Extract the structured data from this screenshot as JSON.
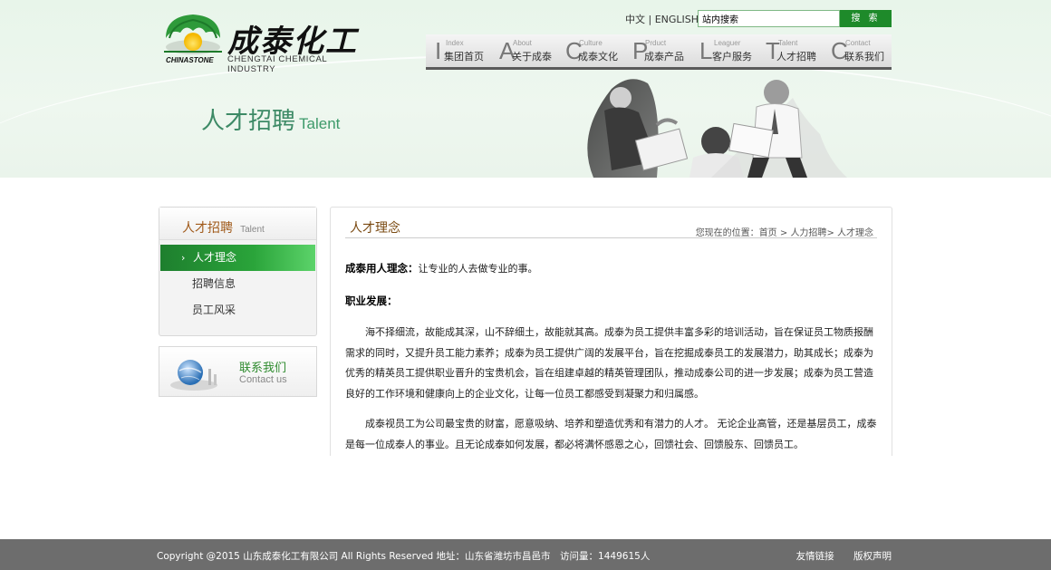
{
  "logo": {
    "brand_cn": "成泰化工",
    "brand_en": "CHENGTAI CHEMICAL INDUSTRY",
    "brand_small": "CHINASTONE"
  },
  "header": {
    "lang_cn": "中文",
    "lang_sep": "|",
    "lang_en": "ENGLISH",
    "search_value": "站内搜索",
    "search_button": "搜 索"
  },
  "nav": [
    {
      "letter": "I",
      "en": "Index",
      "cn": "集团首页"
    },
    {
      "letter": "A",
      "en": "About",
      "cn": "关于成泰"
    },
    {
      "letter": "C",
      "en": "Culture",
      "cn": "成泰文化"
    },
    {
      "letter": "P",
      "en": "Prduct",
      "cn": "成泰产品"
    },
    {
      "letter": "L",
      "en": "Leaguer",
      "cn": "客户服务"
    },
    {
      "letter": "T",
      "en": "Talent",
      "cn": "人才招聘"
    },
    {
      "letter": "C",
      "en": "Contact",
      "cn": "联系我们"
    }
  ],
  "banner": {
    "title_cn": "人才招聘",
    "title_en": "Talent"
  },
  "sidebar": {
    "title_cn": "人才招聘",
    "title_en": "Talent",
    "items": [
      {
        "label": "人才理念"
      },
      {
        "label": "招聘信息"
      },
      {
        "label": "员工风采"
      }
    ],
    "contact_cn": "联系我们",
    "contact_en": "Contact us"
  },
  "main": {
    "title": "人才理念",
    "breadcrumb_prefix": "您现在的位置：",
    "breadcrumb": [
      "首页",
      "人力招聘",
      "人才理念"
    ],
    "concept_label": "成泰用人理念：",
    "concept_text": "让专业的人去做专业的事。",
    "career_label": "职业发展：",
    "para1": "海不择细流，故能成其深，山不辞细土，故能就其高。成泰为员工提供丰富多彩的培训活动，旨在保证员工物质报酬需求的同时，又提升员工能力素养；成泰为员工提供广阔的发展平台，旨在挖掘成泰员工的发展潜力，助其成长；成泰为优秀的精英员工提供职业晋升的宝贵机会，旨在组建卓越的精英管理团队，推动成泰公司的进一步发展；成泰为员工营造良好的工作环境和健康向上的企业文化，让每一位员工都感受到凝聚力和归属感。",
    "para2": "成泰视员工为公司最宝贵的财富，愿意吸纳、培养和塑造优秀和有潜力的人才。 无论企业高管，还是基层员工，成泰是每一位成泰人的事业。且无论成泰如何发展，都必将满怀感恩之心，回馈社会、回馈股东、回馈员工。"
  },
  "footer": {
    "copyright": "Copyright @2015 山东成泰化工有限公司 All Rights Reserved 地址：山东省潍坊市昌邑市　访问量：1449615人",
    "link1": "友情链接",
    "link2": "版权声明"
  },
  "colors": {
    "accent_green": "#1e8a2a",
    "title_brown": "#7a4a12",
    "footer_bg": "#6d6d6d",
    "banner_bg": "#e8f5ea"
  }
}
